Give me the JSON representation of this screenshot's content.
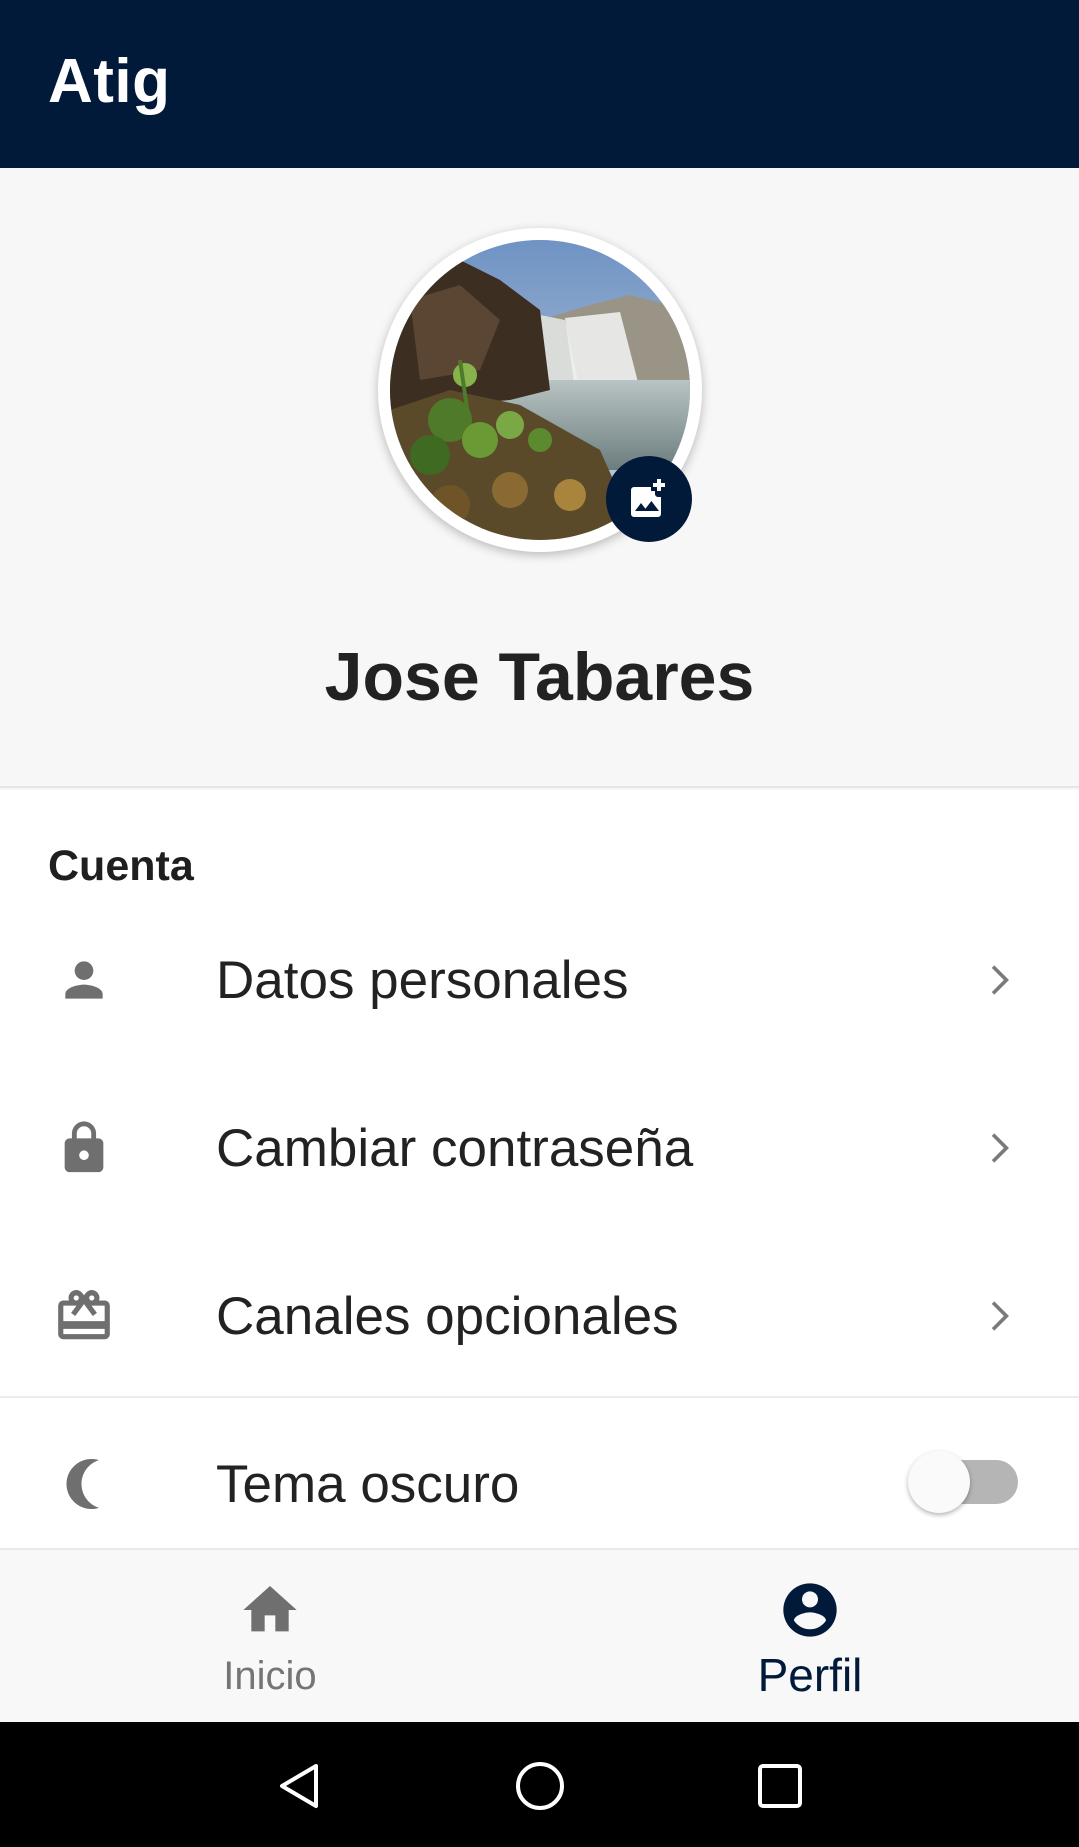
{
  "appbar": {
    "title": "Atig",
    "background": "#021a3a"
  },
  "profile": {
    "avatar_alt": "waterfall landscape photo",
    "change_photo_icon": "add-photo-icon",
    "name": "Jose Tabares"
  },
  "account": {
    "header": "Cuenta",
    "items": [
      {
        "icon": "person-icon",
        "label": "Datos personales",
        "trailing": "chevron-right-icon"
      },
      {
        "icon": "lock-icon",
        "label": "Cambiar contraseña",
        "trailing": "chevron-right-icon"
      },
      {
        "icon": "card-giftcard-icon",
        "label": "Canales opcionales",
        "trailing": "chevron-right-icon"
      }
    ]
  },
  "settings": {
    "dark_theme": {
      "icon": "moon-icon",
      "label": "Tema oscuro",
      "enabled": false
    }
  },
  "bottom_nav": {
    "items": [
      {
        "icon": "home-icon",
        "label": "Inicio",
        "active": false
      },
      {
        "icon": "account-circle-icon",
        "label": "Perfil",
        "active": true
      }
    ],
    "active_color": "#021a3a",
    "inactive_color": "#757575"
  },
  "system_nav": {
    "buttons": [
      "back-icon",
      "home-circle-icon",
      "recents-icon"
    ]
  }
}
